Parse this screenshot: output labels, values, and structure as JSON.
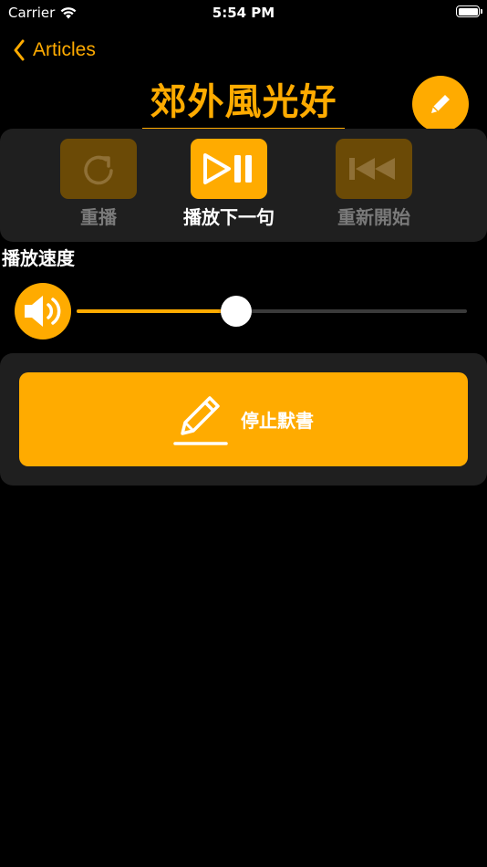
{
  "status_bar": {
    "carrier": "Carrier",
    "time": "5:54 PM"
  },
  "nav": {
    "back_label": "Articles",
    "title": "郊外風光好"
  },
  "playback": {
    "replay_label": "重播",
    "play_next_label": "播放下一句",
    "restart_label": "重新開始"
  },
  "speed": {
    "label": "播放速度",
    "value_fraction": 0.41
  },
  "dictation": {
    "stop_label": "停止默書"
  },
  "colors": {
    "accent": "#ffab00",
    "background": "#000000",
    "panel": "#1f1f1f",
    "disabled_button": "#6b4a06",
    "disabled_text": "#7a7a7a"
  },
  "icons": {
    "back": "chevron-left-icon",
    "edit": "pencil-icon",
    "replay": "replay-icon",
    "play_pause": "play-pause-icon",
    "restart": "rewind-icon",
    "volume": "speaker-icon",
    "dictation": "pencil-underline-icon"
  }
}
